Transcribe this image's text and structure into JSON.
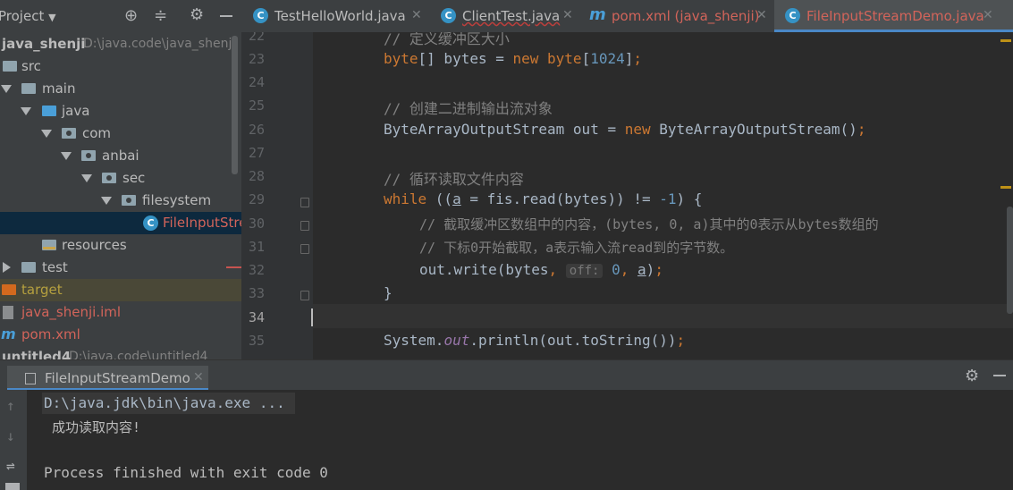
{
  "project_panel": {
    "title": "Project",
    "tree": [
      {
        "label": "java_shenji",
        "path": "D:\\java.code\\java_shenji"
      },
      {
        "label": "src"
      },
      {
        "label": "main"
      },
      {
        "label": "java"
      },
      {
        "label": "com"
      },
      {
        "label": "anbai"
      },
      {
        "label": "sec"
      },
      {
        "label": "filesystem"
      },
      {
        "label": "FileInputStreamDemo"
      },
      {
        "label": "resources"
      },
      {
        "label": "test"
      },
      {
        "label": "target"
      },
      {
        "label": "java_shenji.iml"
      },
      {
        "label": "pom.xml"
      },
      {
        "label": "untitled4",
        "path": "D:\\java.code\\untitled4"
      }
    ]
  },
  "tabs": [
    {
      "label": "TestHelloWorld.java",
      "icon": "java-class-icon",
      "color": "#a9b7c6"
    },
    {
      "label": "ClientTest.java",
      "icon": "java-class-icon",
      "color": "#a9b7c6"
    },
    {
      "label": "pom.xml (java_shenji)",
      "icon": "maven-icon",
      "color": "#d2645a"
    },
    {
      "label": "FileInputStreamDemo.java",
      "icon": "java-class-icon",
      "color": "#d2645a"
    }
  ],
  "editor": {
    "line_numbers": [
      "22",
      "23",
      "24",
      "25",
      "26",
      "27",
      "28",
      "29",
      "30",
      "31",
      "32",
      "33",
      "34",
      "35"
    ],
    "l22_comment": "// 定义缓冲区大小",
    "l23_kw1": "byte",
    "l23_a": "[] bytes = ",
    "l23_kw2": "new byte",
    "l23_b": "[",
    "l23_num": "1024",
    "l23_c": "]",
    "l23_semi": ";",
    "l25_comment": "// 创建二进制输出流对象",
    "l26_a": "ByteArrayOutputStream out = ",
    "l26_kw": "new ",
    "l26_b": "ByteArrayOutputStream()",
    "l26_semi": ";",
    "l28_comment": "// 循环读取文件内容",
    "l29_kw": "while ",
    "l29_a": "((",
    "l29_var": "a",
    "l29_b": " = fis.read(bytes)) != ",
    "l29_num": "-1",
    "l29_c": ") {",
    "l30_comment": "// 截取缓冲区数组中的内容，(bytes, 0, a)其中的0表示从bytes数组的",
    "l31_comment": "// 下标0开始截取，a表示输入流read到的字节数。",
    "l32_a": "out.write(bytes",
    "l32_comma1": ", ",
    "l32_hint": "off:",
    "l32_num": "0",
    "l32_comma2": ", ",
    "l32_var": "a",
    "l32_b": ")",
    "l32_semi": ";",
    "l33_brace": "}",
    "l35_a": "System.",
    "l35_field": "out",
    "l35_b": ".println(out.toString())",
    "l35_semi": ";"
  },
  "run_window": {
    "tab_label": "FileInputStreamDemo",
    "console_lines": [
      "D:\\java.jdk\\bin\\java.exe ...",
      " 成功读取内容!",
      "",
      "Process finished with exit code 0"
    ]
  },
  "colors": {
    "keyword": "#cc7832",
    "number": "#6897bb",
    "comment": "#808080",
    "field": "#9876aa",
    "accent": "#4a88c7"
  }
}
